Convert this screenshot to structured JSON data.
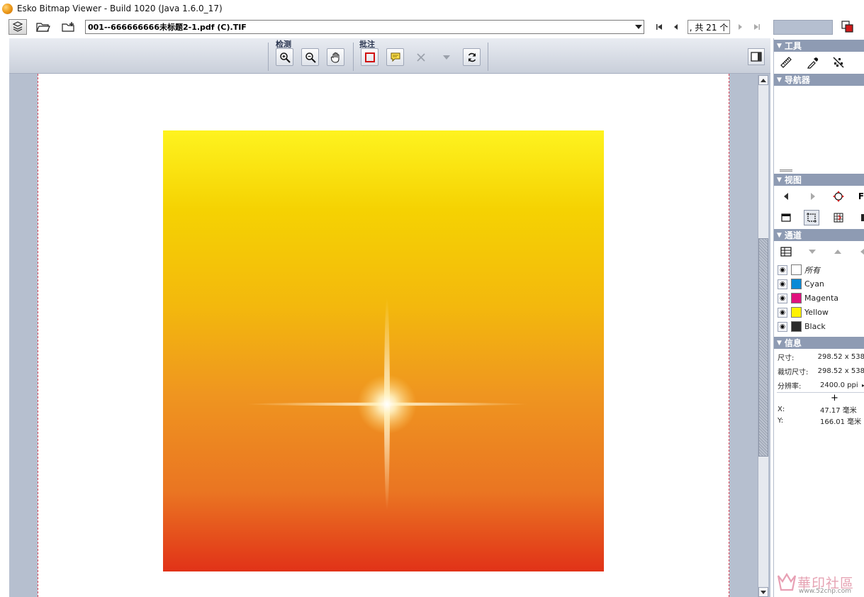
{
  "window": {
    "title": "Esko Bitmap Viewer - Build 1020 (Java 1.6.0_17)"
  },
  "toolbar": {
    "file_name": "001--666666666未标题2-1.pdf (C).TIF",
    "page_indicator": ", 共 21 个"
  },
  "sections": {
    "inspect_label": "检测",
    "annotate_label": "批注"
  },
  "panel": {
    "tools_header": "工具",
    "navigator_header": "导航器",
    "view_header": "视图",
    "channels_header": "通道",
    "info_header": "信息",
    "view_letter": "F",
    "channels": [
      {
        "name": "所有",
        "color": "#ffffff"
      },
      {
        "name": "Cyan",
        "color": "#0a8ad6"
      },
      {
        "name": "Magenta",
        "color": "#e0117e"
      },
      {
        "name": "Yellow",
        "color": "#fff200"
      },
      {
        "name": "Black",
        "color": "#2b2b2b"
      }
    ],
    "info": {
      "size_label": "尺寸:",
      "size_value": "298.52 x 538",
      "crop_label": "裁切尺寸:",
      "crop_value": "298.52 x 538",
      "res_label": "分辨率:",
      "res_value": "2400.0 ppi",
      "x_label": "X:",
      "x_value": "47.17 毫米",
      "y_label": "Y:",
      "y_value": "166.01 毫米"
    }
  },
  "watermark": {
    "brand": "華印社區",
    "site": "www.52cnp.com"
  },
  "colors": {
    "panel_header": "#8e9bb3",
    "viewer_bg": "#b6bfcf",
    "crop_line": "#d9485a"
  }
}
